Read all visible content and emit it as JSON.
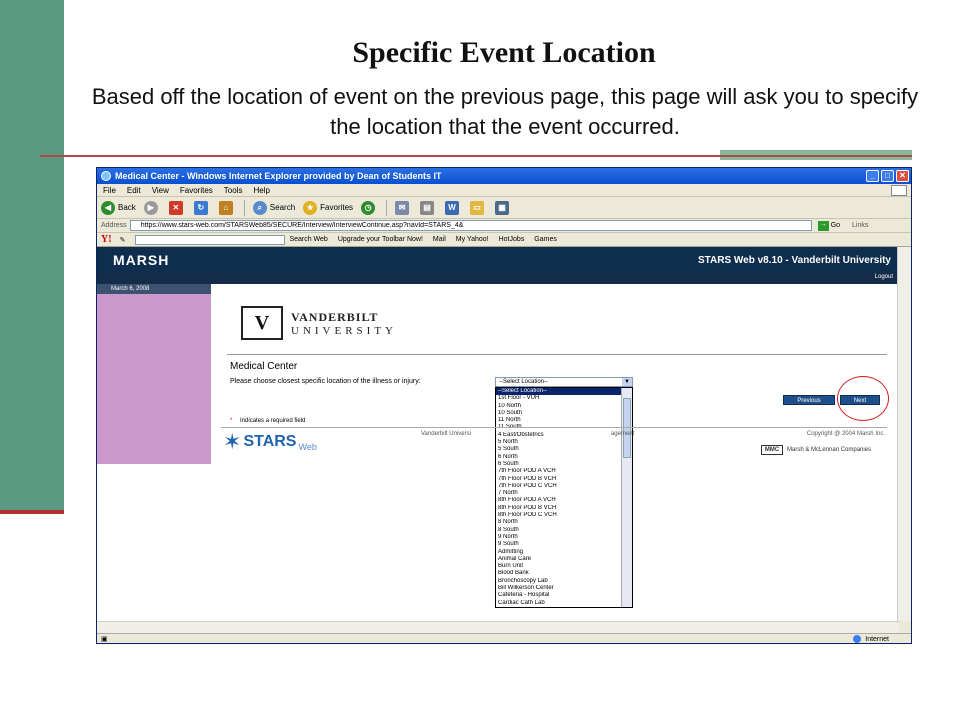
{
  "slide": {
    "title": "Specific Event Location",
    "subtitle": "Based off the location of event on the previous page, this page will ask you to specify the location that the event occurred."
  },
  "window": {
    "title": "Medical Center - Windows Internet Explorer provided by Dean of Students IT"
  },
  "menu": [
    "File",
    "Edit",
    "View",
    "Favorites",
    "Tools",
    "Help"
  ],
  "toolbar": {
    "back": "Back",
    "search": "Search",
    "favorites": "Favorites"
  },
  "address": {
    "label": "Address",
    "url": "https://www.stars-web.com/STARSWeb85/SECURE/Interview/InterviewContinue.asp?navId=STARS_4&",
    "go": "Go",
    "links": "Links"
  },
  "yahoo": {
    "logo": "Y!",
    "items": [
      "Search Web",
      "Upgrade your Toolbar Now!",
      "Mail",
      "My Yahoo!",
      "HotJobs",
      "Games"
    ]
  },
  "app": {
    "brand": "MARSH",
    "version": "STARS Web v8.10 - Vanderbilt University",
    "logout": "Logout",
    "date": "March 6, 2008"
  },
  "university": {
    "line1": "VANDERBILT",
    "line2": "UNIVERSITY"
  },
  "form": {
    "title": "Medical Center",
    "label": "Please choose closest specific location of the illness or injury:",
    "selected": "--Select Location--",
    "options": [
      "--Select Location--",
      "1st Floor - VUH",
      "10 North",
      "10 South",
      "11 North",
      "11 South",
      "4 East/Obstetrics",
      "5 North",
      "5 South",
      "6 North",
      "6 South",
      "7th Floor POD A VCH",
      "7th Floor POD B VCH",
      "7th Floor POD C VCH",
      "7 North",
      "8th Floor POD A VCH",
      "8th Floor POD B VCH",
      "8th Floor POD C VCH",
      "8 North",
      "8 South",
      "9 North",
      "9 South",
      "Admitting",
      "Animal Care",
      "Burn Unit",
      "Blood Bank",
      "Bronchoscopy Lab",
      "Bill Wilkerson Center",
      "Cafeteria - Hospital",
      "Cardiac Cath Lab"
    ],
    "previous": "Previous",
    "next": "Next",
    "required_star": "*",
    "required_text": "Indicates a required field"
  },
  "footer": {
    "center_left": "Vanderbilt Universi",
    "center_right": "agement",
    "copyright": "Copyright @ 2004 Marsh Inc.",
    "stars": "STARS",
    "web": "Web",
    "mmc": "MMC",
    "mmc_name": "Marsh & McLennan Companies"
  },
  "status": {
    "zone": "Internet"
  },
  "colors": {
    "slide_green": "#5a9a82",
    "marsh_navy": "#0f2e4e",
    "left_panel": "#cc99cc",
    "highlight_red": "#d02020"
  }
}
